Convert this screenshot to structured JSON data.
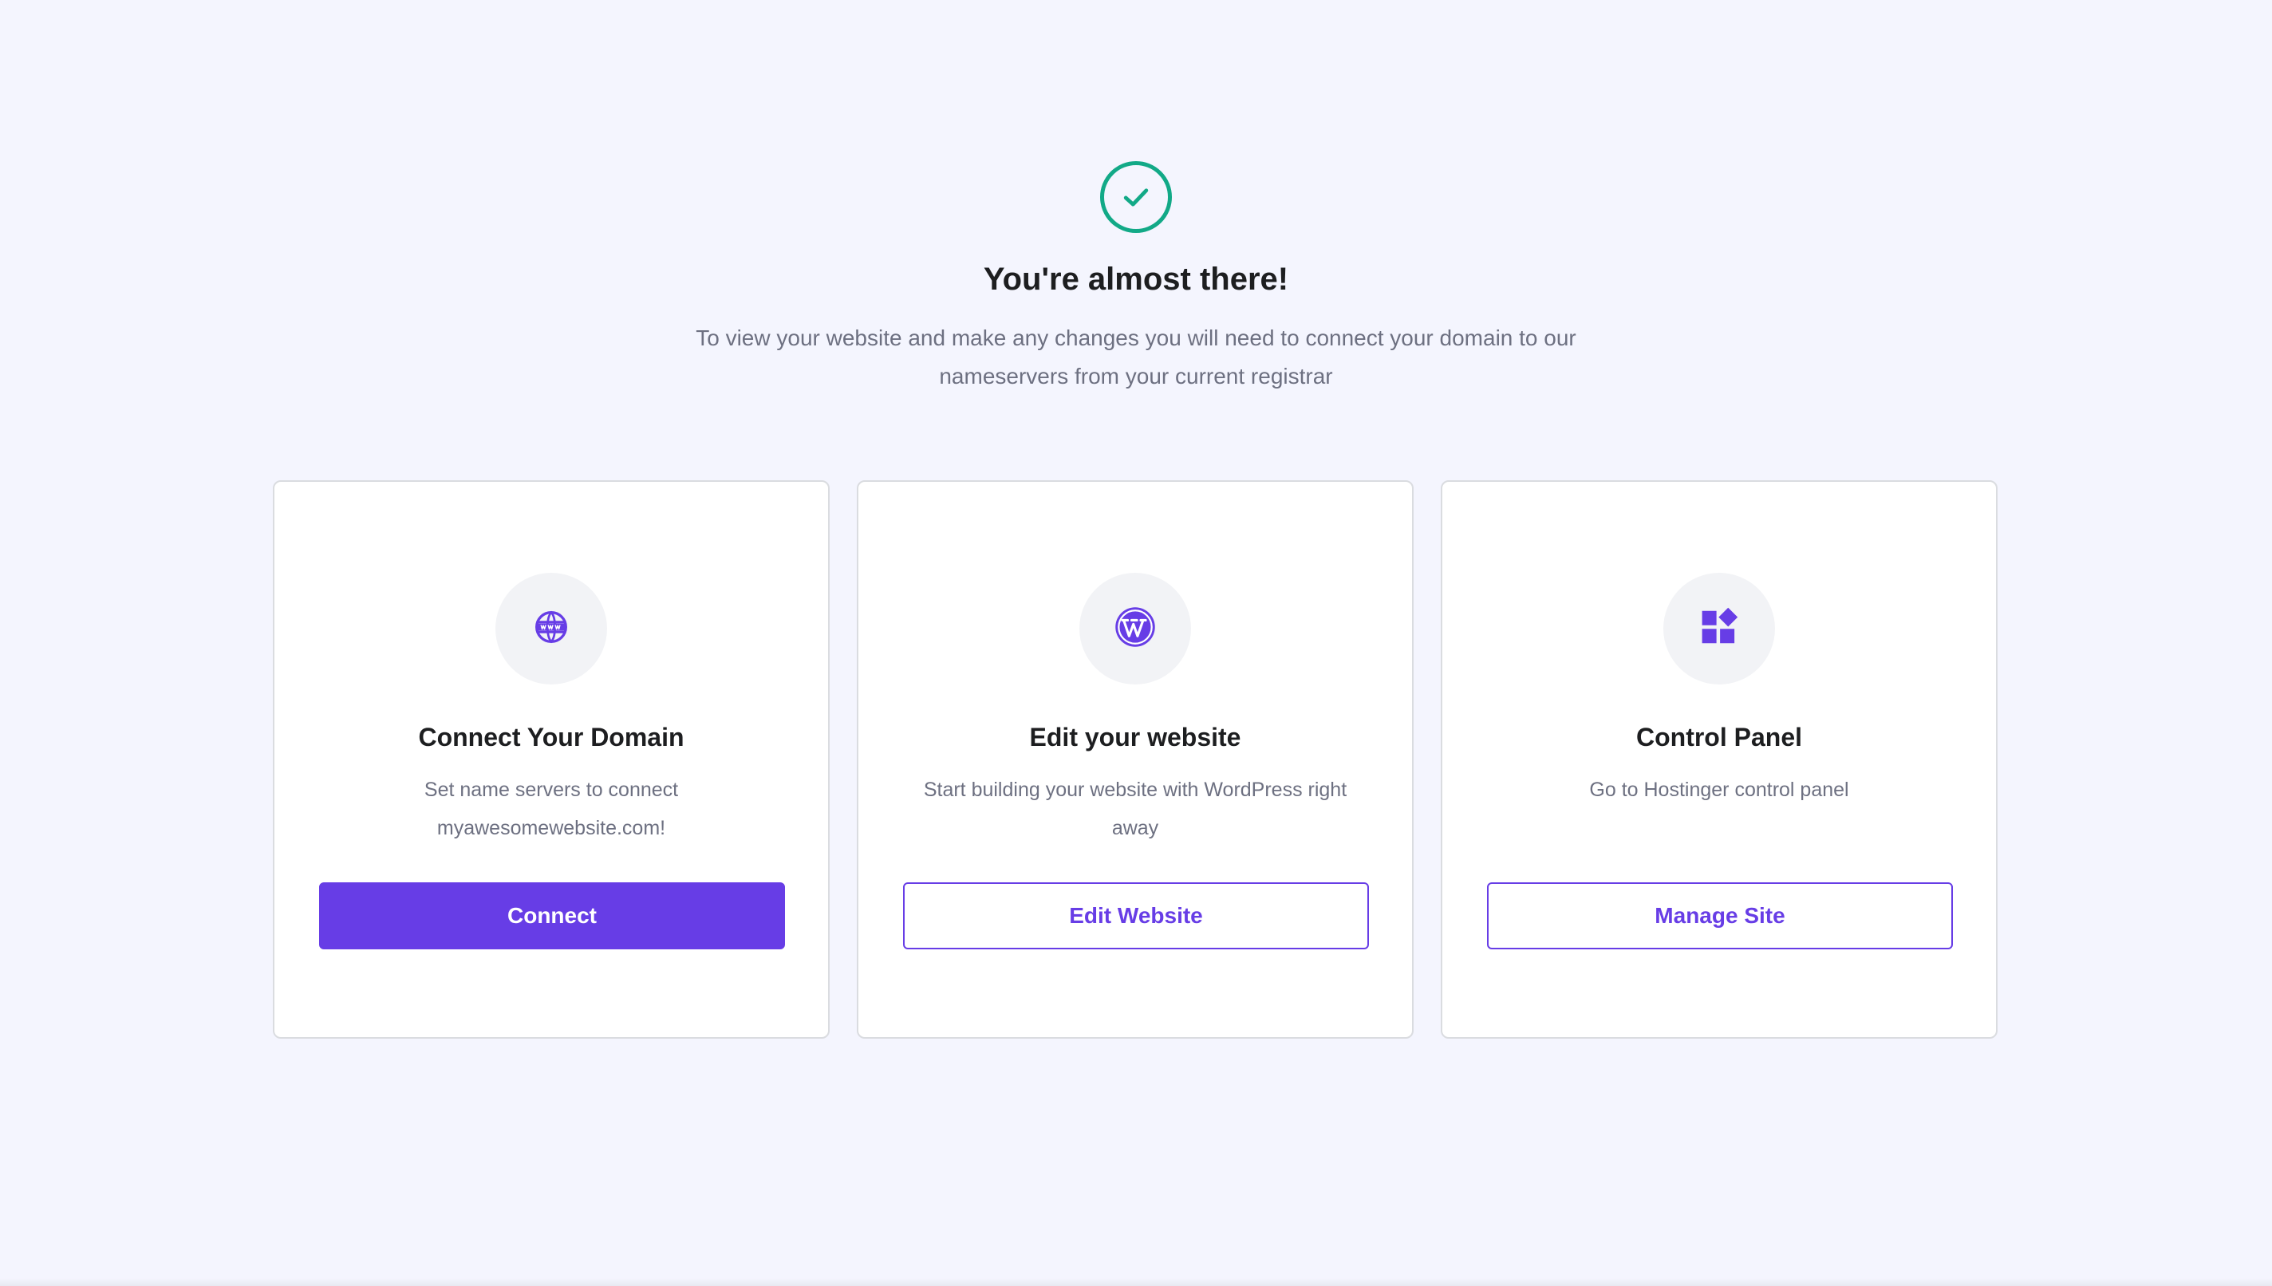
{
  "hero": {
    "icon": "check-circle-icon",
    "title": "You're almost there!",
    "subtitle_line1": "To view your website and make any changes you will need to connect your domain to our",
    "subtitle_line2": "nameservers from your current registrar"
  },
  "cards": [
    {
      "icon": "www-globe-icon",
      "title": "Connect Your Domain",
      "desc_line1": "Set name servers to connect",
      "desc_line2": "myawesomewebsite.com!",
      "button": "Connect"
    },
    {
      "icon": "wordpress-icon",
      "title": "Edit your website",
      "desc_line1": "Start building your website with WordPress right",
      "desc_line2": "away",
      "button": "Edit Website"
    },
    {
      "icon": "control-panel-icon",
      "title": "Control Panel",
      "desc_line1": "Go to Hostinger control panel",
      "desc_line2": "",
      "button": "Manage Site"
    }
  ],
  "colors": {
    "background": "#f4f5fe",
    "accent": "#673de6",
    "success": "#12a987",
    "text": "#1d1e20",
    "muted_text": "#6d7081",
    "icon_bg": "#f2f3f6"
  }
}
